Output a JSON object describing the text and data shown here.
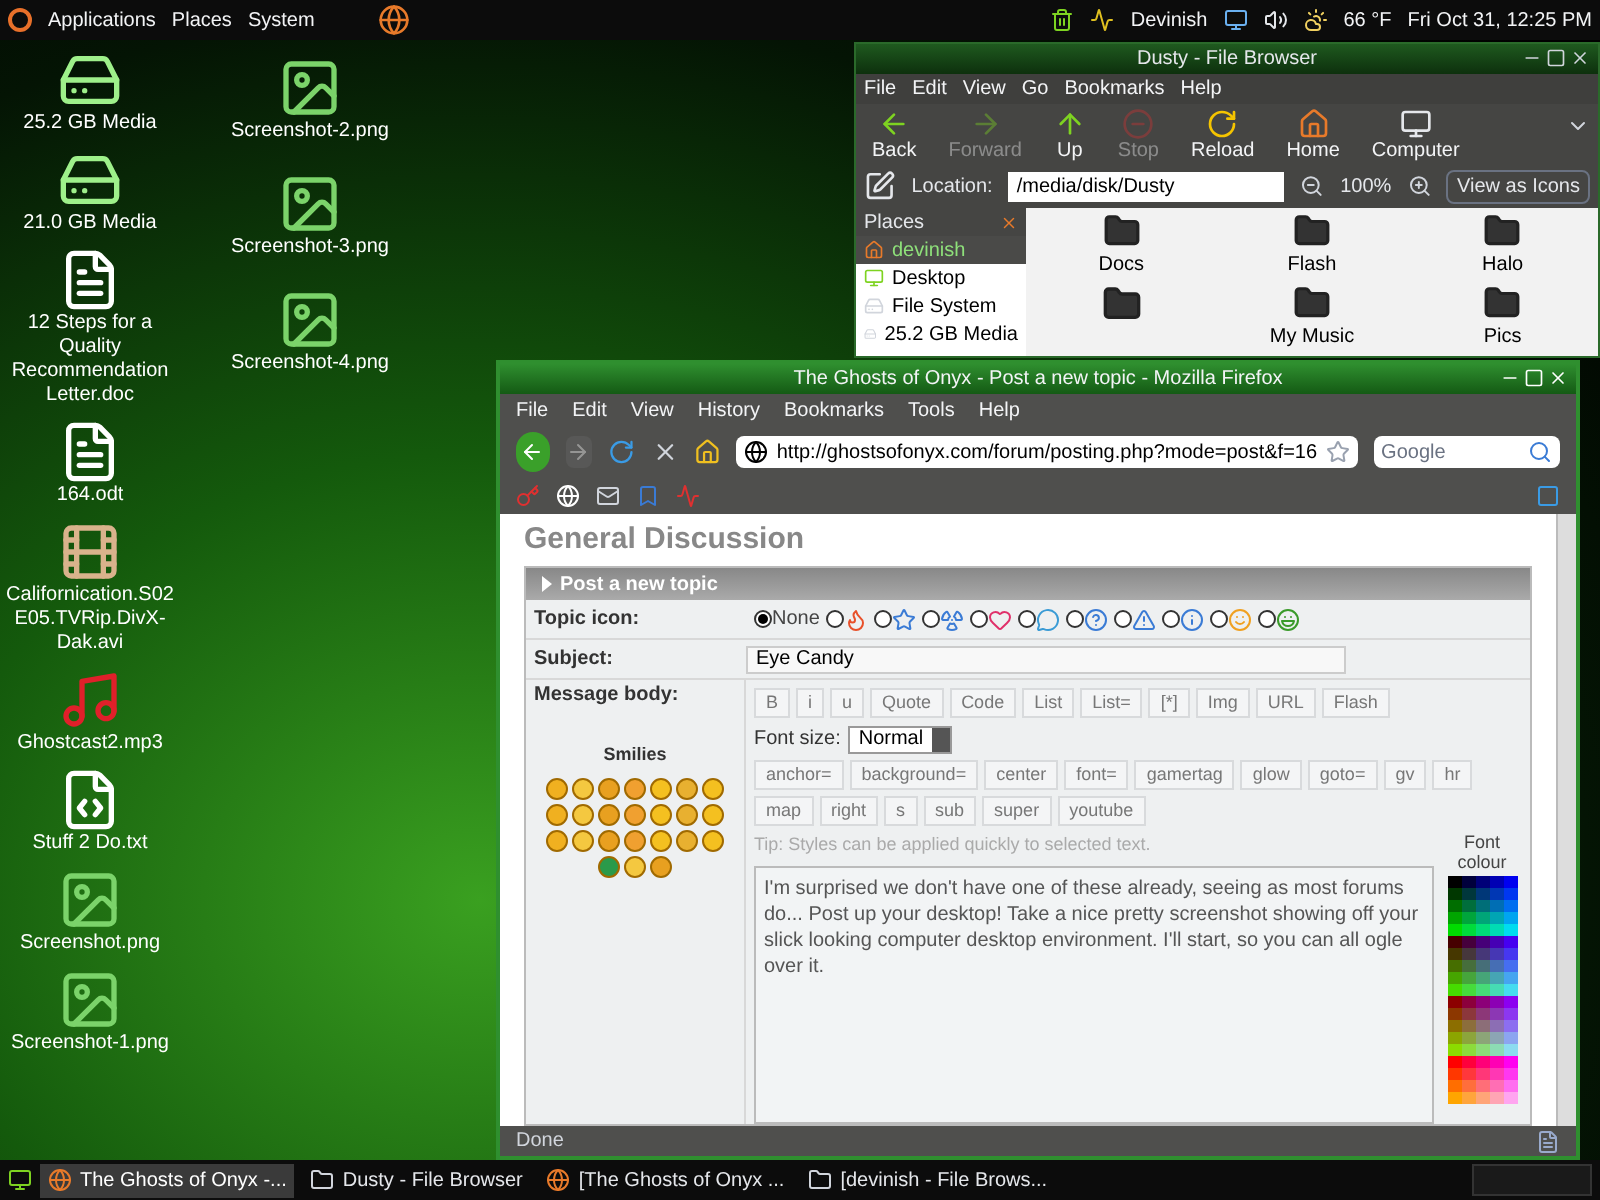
{
  "top_panel": {
    "menus": [
      "Applications",
      "Places",
      "System"
    ],
    "user": "Devinish",
    "weather": "66 °F",
    "clock": "Fri Oct 31, 12:25 PM"
  },
  "desktop": {
    "left_column": [
      {
        "label": "25.2 GB Media",
        "kind": "drive"
      },
      {
        "label": "21.0 GB Media",
        "kind": "drive"
      },
      {
        "label": "12 Steps for a Quality Recommendation Letter.doc",
        "kind": "document"
      },
      {
        "label": "164.odt",
        "kind": "document"
      },
      {
        "label": "Californication.S02E05.TVRip.DivX-Dak.avi",
        "kind": "video"
      },
      {
        "label": "Ghostcast2.mp3",
        "kind": "audio"
      },
      {
        "label": "Stuff 2 Do.txt",
        "kind": "text"
      },
      {
        "label": "Screenshot.png",
        "kind": "image"
      },
      {
        "label": "Screenshot-1.png",
        "kind": "image"
      }
    ],
    "right_column": [
      {
        "label": "Screenshot-2.png",
        "kind": "image"
      },
      {
        "label": "Screenshot-3.png",
        "kind": "image"
      },
      {
        "label": "Screenshot-4.png",
        "kind": "image"
      }
    ]
  },
  "file_browser": {
    "title": "Dusty - File Browser",
    "menus": [
      "File",
      "Edit",
      "View",
      "Go",
      "Bookmarks",
      "Help"
    ],
    "toolbar": [
      {
        "label": "Back",
        "kind": "back",
        "disabled": false
      },
      {
        "label": "Forward",
        "kind": "forward",
        "disabled": true
      },
      {
        "label": "Up",
        "kind": "up",
        "disabled": false
      },
      {
        "label": "Stop",
        "kind": "stop",
        "disabled": true
      },
      {
        "label": "Reload",
        "kind": "reload",
        "disabled": false
      },
      {
        "label": "Home",
        "kind": "home",
        "disabled": false
      },
      {
        "label": "Computer",
        "kind": "computer",
        "disabled": false
      }
    ],
    "location_label": "Location:",
    "location": "/media/disk/Dusty",
    "zoom": "100%",
    "view_mode": "View as Icons",
    "places_title": "Places",
    "places": [
      {
        "label": "devinish",
        "kind": "home",
        "selected": true
      },
      {
        "label": "Desktop",
        "kind": "desktop",
        "selected": false
      },
      {
        "label": "File System",
        "kind": "drive",
        "selected": false
      },
      {
        "label": "25.2 GB Media",
        "kind": "drive",
        "selected": false
      }
    ],
    "folders": [
      {
        "kind": "folder",
        "label": "Docs"
      },
      {
        "kind": "folder",
        "label": "Flash"
      },
      {
        "kind": "folder",
        "label": "Halo"
      },
      {
        "kind": "folder"
      },
      {
        "kind": "folder",
        "label": "My Music"
      },
      {
        "kind": "folder",
        "label": "Pics"
      }
    ]
  },
  "firefox": {
    "title": "The Ghosts of Onyx - Post a new topic - Mozilla Firefox",
    "menus": [
      "File",
      "Edit",
      "View",
      "History",
      "Bookmarks",
      "Tools",
      "Help"
    ],
    "back_disabled": false,
    "forward_disabled": true,
    "url": "http://ghostsofonyx.com/forum/posting.php?mode=post&f=16",
    "search_placeholder": "Google",
    "page": {
      "heading": "General Discussion",
      "panel_title": "Post a new topic",
      "topic_icon_label": "Topic icon:",
      "topic_icons": [
        {
          "kind": "none",
          "label": "None",
          "selected": true
        },
        {
          "kind": "fire",
          "selected": false
        },
        {
          "kind": "star",
          "selected": false
        },
        {
          "kind": "radiation",
          "selected": false
        },
        {
          "kind": "heart",
          "selected": false
        },
        {
          "kind": "speech",
          "selected": false
        },
        {
          "kind": "question",
          "selected": false
        },
        {
          "kind": "warning",
          "selected": false
        },
        {
          "kind": "info",
          "selected": false
        },
        {
          "kind": "wink",
          "selected": false
        },
        {
          "kind": "grin",
          "selected": false
        }
      ],
      "subject_label": "Subject:",
      "subject": "Eye Candy",
      "body_label": "Message body:",
      "format_buttons": [
        "B",
        "i",
        "u",
        "Quote",
        "Code",
        "List",
        "List=",
        "[*]",
        "Img",
        "URL",
        "Flash"
      ],
      "font_size_label": "Font size:",
      "font_size": "Normal",
      "custom_buttons": [
        "anchor=",
        "background=",
        "center",
        "font=",
        "gamertag",
        "glow",
        "goto=",
        "gv",
        "hr",
        "map",
        "right",
        "s",
        "sub",
        "super",
        "youtube"
      ],
      "tip": "Tip: Styles can be applied quickly to selected text.",
      "smilies_label": "Smilies",
      "message": "I'm surprised we don't have one of these already, seeing as most forums do...  Post up your desktop!  Take a nice pretty screenshot showing off your slick looking computer desktop environment.  I'll start, so you can all ogle over it.",
      "font_colour_label": "Font colour"
    },
    "status": "Done"
  },
  "taskbar": [
    {
      "label": "The Ghosts of Onyx -...",
      "kind": "browser",
      "selected": true
    },
    {
      "label": "Dusty - File Browser",
      "kind": "files",
      "selected": false
    },
    {
      "label": "[The Ghosts of Onyx ...",
      "kind": "browser",
      "selected": false
    },
    {
      "label": "[devinish - File Brows...",
      "kind": "files",
      "selected": false
    }
  ]
}
